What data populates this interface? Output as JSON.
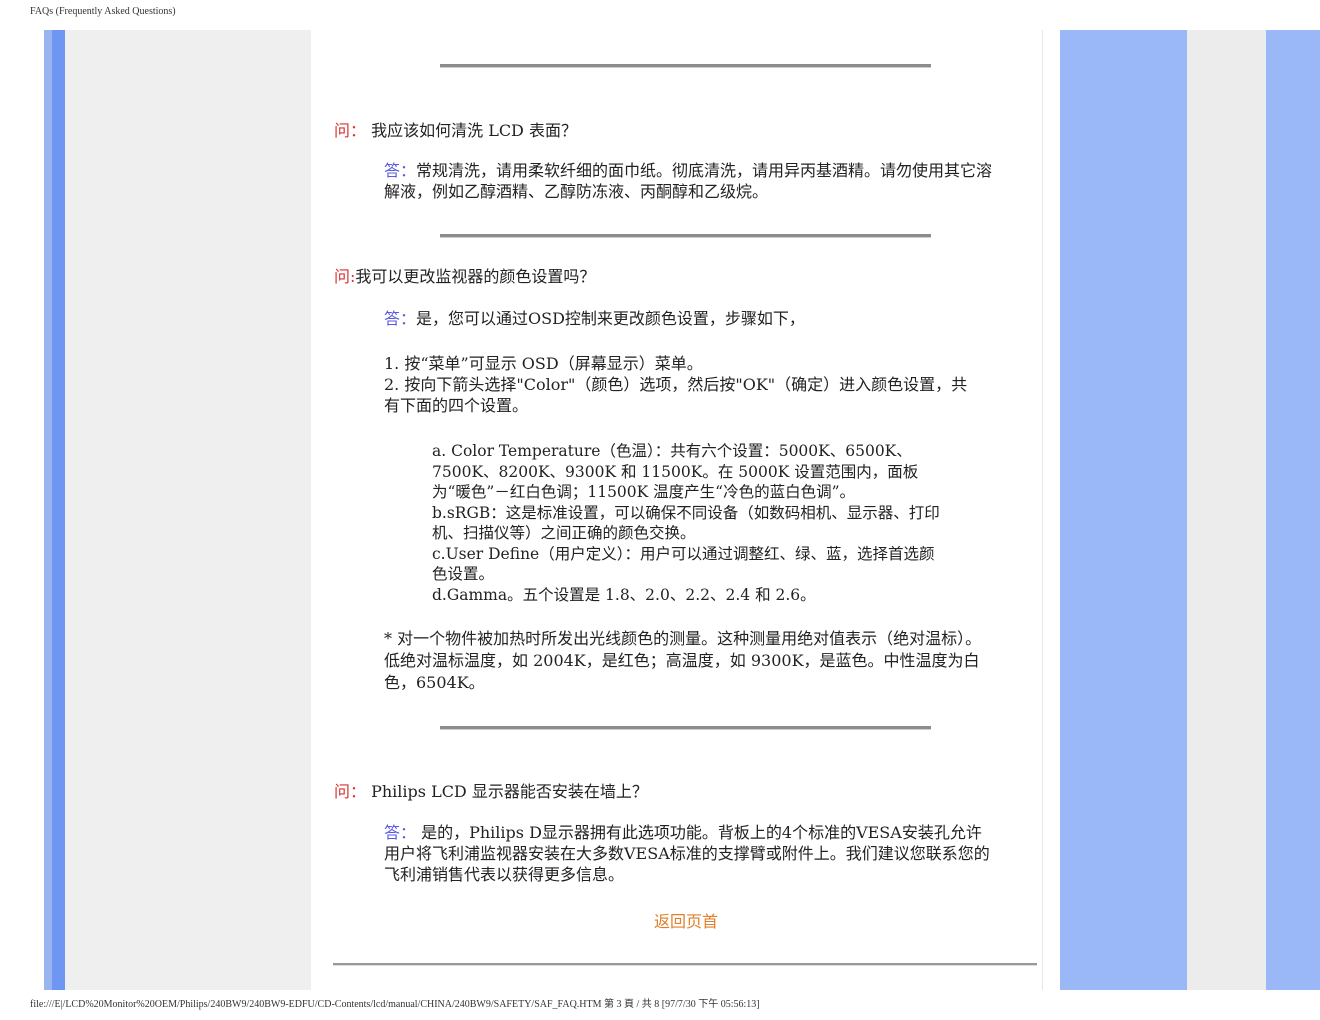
{
  "header": {
    "title": "FAQs (Frequently Asked Questions)"
  },
  "footer": {
    "path": "file:///E|/LCD%20Monitor%20OEM/Philips/240BW9/240BW9-EDFU/CD-Contents/lcd/manual/CHINA/240BW9/SAFETY/SAF_FAQ.HTM 第 3 頁 / 共 8  [97/7/30 下午 05:56:13]"
  },
  "faq": [
    {
      "q_mark": "问：",
      "question": " 我应该如何清洗 LCD  表面？",
      "a_mark": "答：",
      "answer": "常规清洗，请用柔软纤细的面巾纸。彻底清洗，请用异丙基酒精。请勿使用其它溶解液，例如乙醇酒精、乙醇防冻液、丙酮醇和乙级烷。"
    },
    {
      "q_mark": "问:",
      "question": "我可以更改监视器的颜色设置吗？",
      "a_mark": "答：",
      "answer": "是，您可以通过OSD控制来更改颜色设置，步骤如下，",
      "steps": [
        "1. 按“菜单”可显示 OSD（屏幕显示）菜单。",
        "2. 按向下箭头选择\"Color\"（颜色）选项，然后按\"OK\"（确定）进入颜色设置，共有下面的四个设置。"
      ],
      "options": [
        "a. Color Temperature（色温）：共有六个设置：5000K、6500K、7500K、8200K、9300K 和 11500K。在 5000K 设置范围内，面板为“暖色”－红白色调；11500K 温度产生“冷色的蓝白色调”。",
        "b.sRGB：这是标准设置，可以确保不同设备（如数码相机、显示器、打印机、扫描仪等）之间正确的颜色交换。",
        "c.User Define（用户定义）：用户可以通过调整红、绿、蓝，选择首选颜色设置。",
        "d.Gamma。五个设置是 1.8、2.0、2.2、2.4 和 2.6。"
      ],
      "note": "* 对一个物件被加热时所发出光线颜色的测量。这种测量用绝对值表示（绝对温标）。低绝对温标温度，如 2004K，是红色；高温度，如 9300K，是蓝色。中性温度为白色，6504K。"
    },
    {
      "q_mark": "问：",
      "question": " Philips LCD 显示器能否安装在墙上？",
      "a_mark": "答：",
      "answer": " 是的，Philips D显示器拥有此选项功能。背板上的4个标准的VESA安装孔允许用户将飞利浦监视器安装在大多数VESA标准的支撑臂或附件上。我们建议您联系您的飞利浦销售代表以获得更多信息。"
    }
  ],
  "back_link": "返回页首"
}
